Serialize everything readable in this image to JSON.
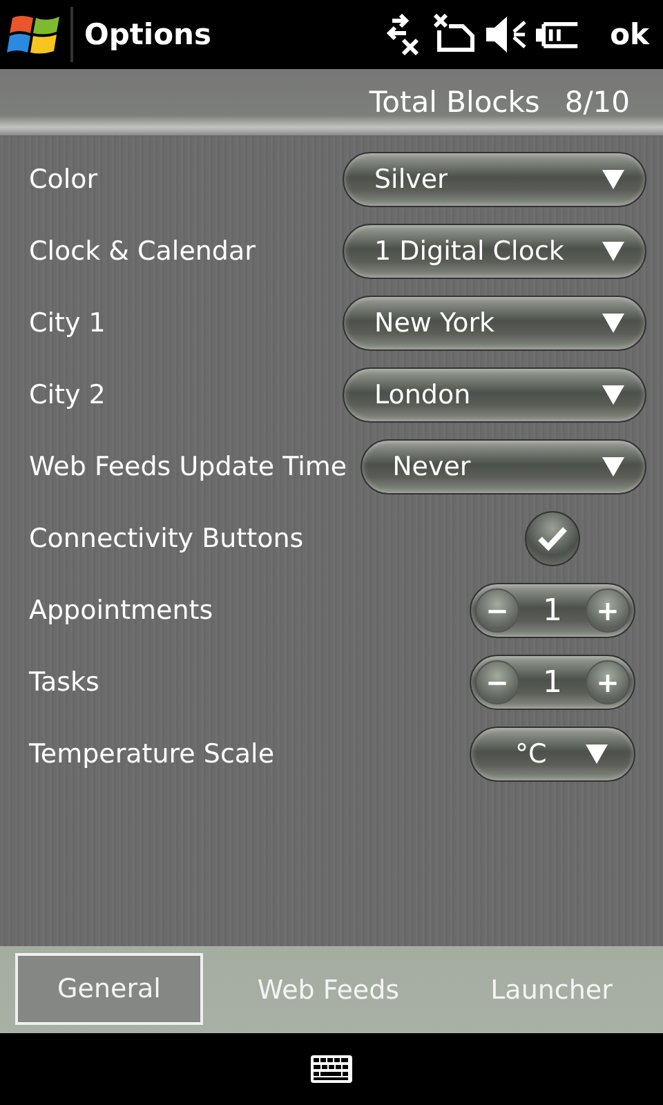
{
  "title_bar": {
    "title": "Options",
    "ok": "ok"
  },
  "header": {
    "label": "Total Blocks",
    "value": "8/10"
  },
  "settings": [
    {
      "kind": "dropdown",
      "label": "Color",
      "value": "Silver"
    },
    {
      "kind": "dropdown",
      "label": "Clock & Calendar",
      "value": "1 Digital Clock"
    },
    {
      "kind": "dropdown",
      "label": "City 1",
      "value": "New York"
    },
    {
      "kind": "dropdown",
      "label": "City 2",
      "value": "London"
    },
    {
      "kind": "dropdown",
      "label": "Web Feeds Update Time",
      "value": "Never"
    },
    {
      "kind": "check",
      "label": "Connectivity Buttons",
      "checked": true
    },
    {
      "kind": "stepper",
      "label": "Appointments",
      "value": "1",
      "minus": "−",
      "plus": "+"
    },
    {
      "kind": "stepper",
      "label": "Tasks",
      "value": "1",
      "minus": "−",
      "plus": "+"
    },
    {
      "kind": "unit",
      "label": "Temperature Scale",
      "value": "°C"
    }
  ],
  "tabs": [
    {
      "label": "General",
      "selected": true
    },
    {
      "label": "Web Feeds",
      "selected": false
    },
    {
      "label": "Launcher",
      "selected": false
    }
  ]
}
